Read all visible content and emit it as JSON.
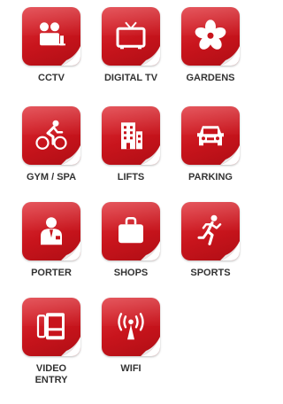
{
  "accent_color": "#c8141c",
  "amenities": [
    {
      "label": "CCTV",
      "icon": "cctv-camera-icon"
    },
    {
      "label": "DIGITAL TV",
      "icon": "television-icon"
    },
    {
      "label": "GARDENS",
      "icon": "flower-icon"
    },
    {
      "label": "GYM / SPA",
      "icon": "cyclist-icon"
    },
    {
      "label": "LIFTS",
      "icon": "building-icon"
    },
    {
      "label": "PARKING",
      "icon": "car-icon"
    },
    {
      "label": "PORTER",
      "icon": "porter-icon"
    },
    {
      "label": "SHOPS",
      "icon": "shopping-bag-icon"
    },
    {
      "label": "SPORTS",
      "icon": "runner-icon"
    },
    {
      "label": "VIDEO\nENTRY",
      "icon": "video-intercom-icon"
    },
    {
      "label": "WIFI",
      "icon": "wifi-tower-icon"
    }
  ]
}
